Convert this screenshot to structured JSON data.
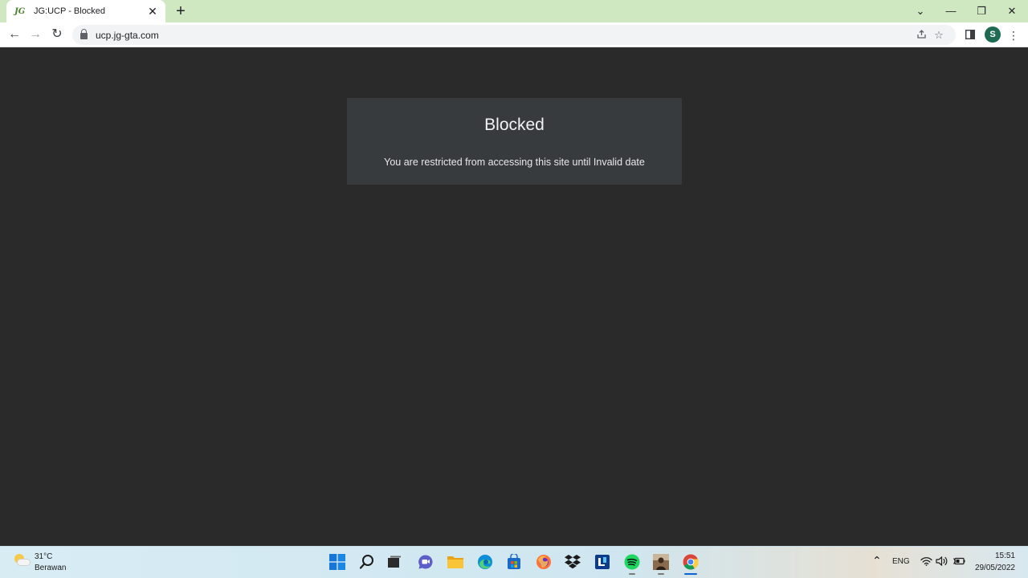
{
  "browser": {
    "tab": {
      "favicon_text": "JG",
      "title": "JG:UCP - Blocked",
      "close_glyph": "✕"
    },
    "new_tab_glyph": "+",
    "window_controls": {
      "tablist": "⌄",
      "minimize": "—",
      "restore": "❐",
      "close": "✕"
    },
    "nav": {
      "back": "←",
      "forward": "→",
      "reload": "↻"
    },
    "address_bar": {
      "url": "ucp.jg-gta.com"
    },
    "profile_initial": "S"
  },
  "page": {
    "title": "Blocked",
    "message": "You are restricted from accessing this site until Invalid date"
  },
  "taskbar": {
    "weather": {
      "temp": "31°C",
      "condition": "Berawan"
    },
    "apps": [
      "start",
      "search",
      "file-explorer",
      "teams-chat",
      "folder",
      "edge",
      "store",
      "firefox",
      "dropbox",
      "app",
      "spotify",
      "photo-app",
      "chrome"
    ],
    "tray": {
      "language": "ENG"
    },
    "clock": {
      "time": "15:51",
      "date": "29/05/2022"
    }
  },
  "colors": {
    "page_bg": "#2a2a2a",
    "card_bg": "#383b3e",
    "tabstrip_bg": "#cfe8c1",
    "accent": "#0a64d8"
  }
}
